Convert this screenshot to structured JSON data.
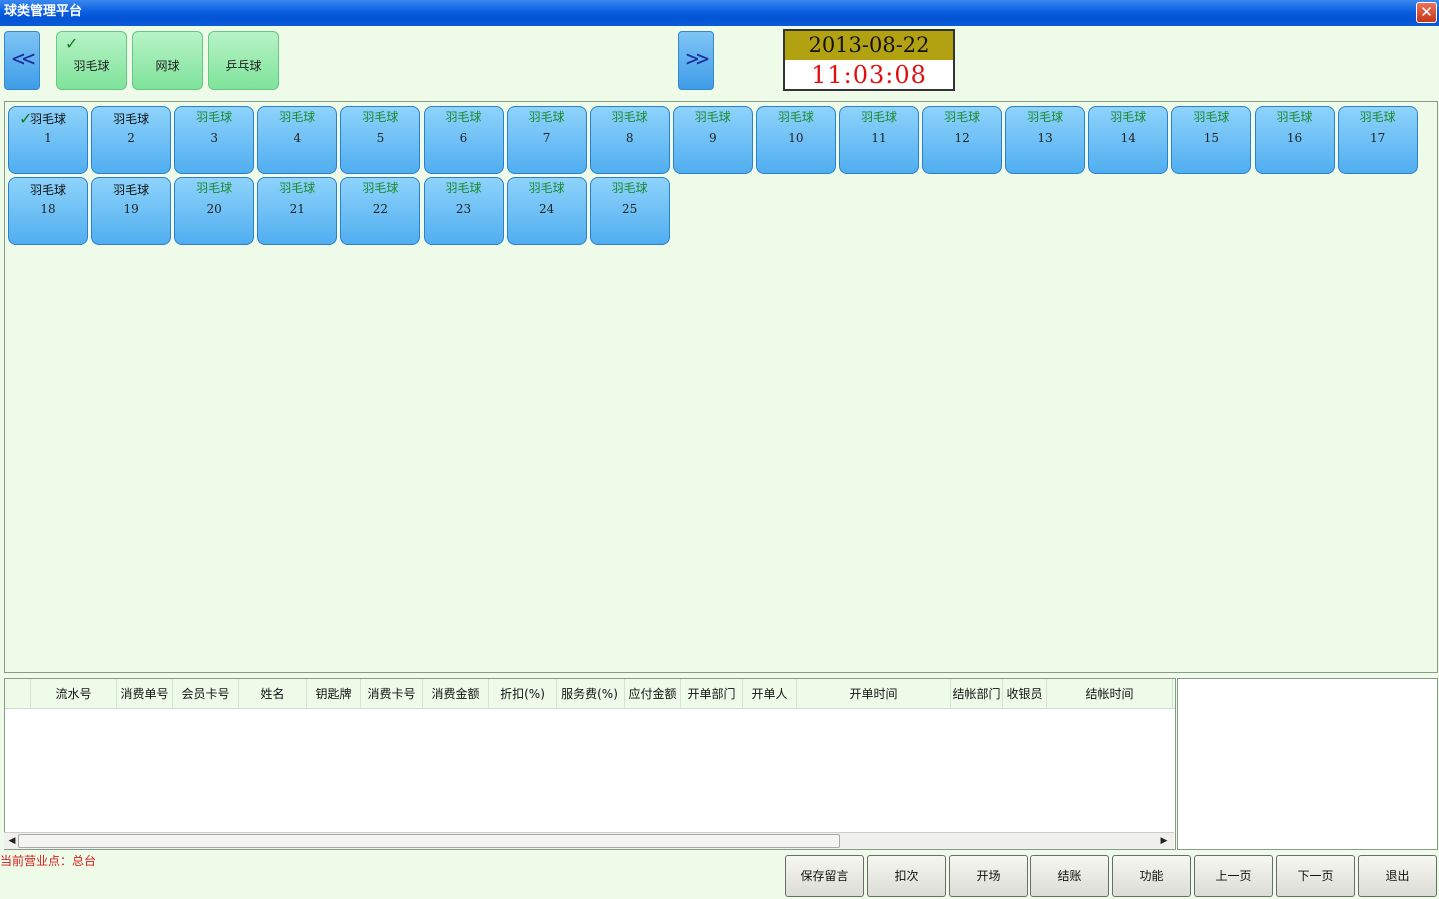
{
  "window": {
    "title": "球类管理平台",
    "close": "✕"
  },
  "nav": {
    "prev": "<<",
    "next": ">>"
  },
  "categories": [
    {
      "label": "羽毛球",
      "selected": true
    },
    {
      "label": "网球",
      "selected": false
    },
    {
      "label": "乒乓球",
      "selected": false
    }
  ],
  "clock": {
    "date": "2013-08-22",
    "time": "11:03:08"
  },
  "courts": [
    {
      "name": "羽毛球",
      "num": "1",
      "checked": true
    },
    {
      "name": "羽毛球",
      "num": "2"
    },
    {
      "name": "羽毛球",
      "num": "3"
    },
    {
      "name": "羽毛球",
      "num": "4"
    },
    {
      "name": "羽毛球",
      "num": "5"
    },
    {
      "name": "羽毛球",
      "num": "6"
    },
    {
      "name": "羽毛球",
      "num": "7"
    },
    {
      "name": "羽毛球",
      "num": "8"
    },
    {
      "name": "羽毛球",
      "num": "9"
    },
    {
      "name": "羽毛球",
      "num": "10"
    },
    {
      "name": "羽毛球",
      "num": "11"
    },
    {
      "name": "羽毛球",
      "num": "12"
    },
    {
      "name": "羽毛球",
      "num": "13"
    },
    {
      "name": "羽毛球",
      "num": "14"
    },
    {
      "name": "羽毛球",
      "num": "15"
    },
    {
      "name": "羽毛球",
      "num": "16"
    },
    {
      "name": "羽毛球",
      "num": "17"
    },
    {
      "name": "羽毛球",
      "num": "18"
    },
    {
      "name": "羽毛球",
      "num": "19"
    },
    {
      "name": "羽毛球",
      "num": "20"
    },
    {
      "name": "羽毛球",
      "num": "21"
    },
    {
      "name": "羽毛球",
      "num": "22"
    },
    {
      "name": "羽毛球",
      "num": "23"
    },
    {
      "name": "羽毛球",
      "num": "24"
    },
    {
      "name": "羽毛球",
      "num": "25"
    }
  ],
  "table": {
    "columns": [
      "",
      "流水号",
      "消费单号",
      "会员卡号",
      "姓名",
      "钥匙牌",
      "消费卡号",
      "消费金额",
      "折扣(%)",
      "服务费(%)",
      "应付金额",
      "开单部门",
      "开单人",
      "开单时间",
      "结帐部门",
      "收银员",
      "结帐时间",
      ""
    ]
  },
  "scroll": {
    "left": "◀",
    "right": "▶"
  },
  "status": {
    "text": "当前营业点：总台"
  },
  "actions": [
    "保存留言",
    "扣次",
    "开场",
    "结账",
    "功能",
    "上一页",
    "下一页",
    "退出"
  ]
}
